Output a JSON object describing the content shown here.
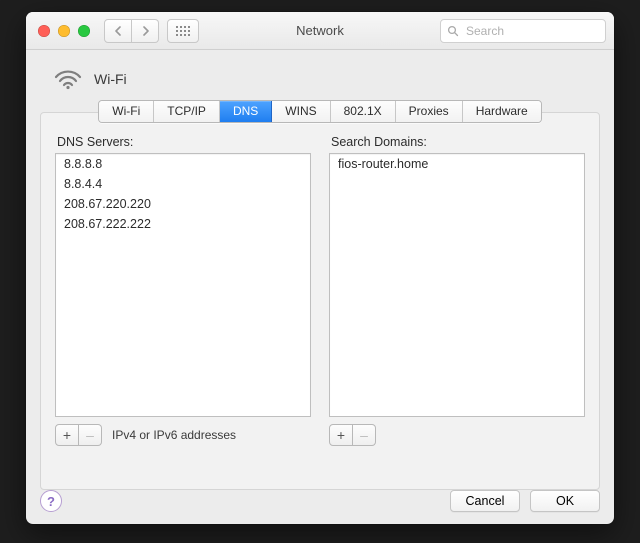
{
  "window": {
    "title": "Network"
  },
  "search": {
    "placeholder": "Search",
    "value": ""
  },
  "header": {
    "connection_label": "Wi-Fi"
  },
  "tabs": [
    {
      "id": "wifi",
      "label": "Wi-Fi",
      "active": false
    },
    {
      "id": "tcpip",
      "label": "TCP/IP",
      "active": false
    },
    {
      "id": "dns",
      "label": "DNS",
      "active": true
    },
    {
      "id": "wins",
      "label": "WINS",
      "active": false
    },
    {
      "id": "8021x",
      "label": "802.1X",
      "active": false
    },
    {
      "id": "proxies",
      "label": "Proxies",
      "active": false
    },
    {
      "id": "hardware",
      "label": "Hardware",
      "active": false
    }
  ],
  "dns": {
    "servers_label": "DNS Servers:",
    "servers": [
      "8.8.8.8",
      "8.8.4.4",
      "208.67.220.220",
      "208.67.222.222"
    ],
    "hint": "IPv4 or IPv6 addresses",
    "domains_label": "Search Domains:",
    "domains": [
      "fios-router.home"
    ]
  },
  "buttons": {
    "add": "+",
    "remove": "–",
    "cancel": "Cancel",
    "ok": "OK",
    "help": "?"
  }
}
